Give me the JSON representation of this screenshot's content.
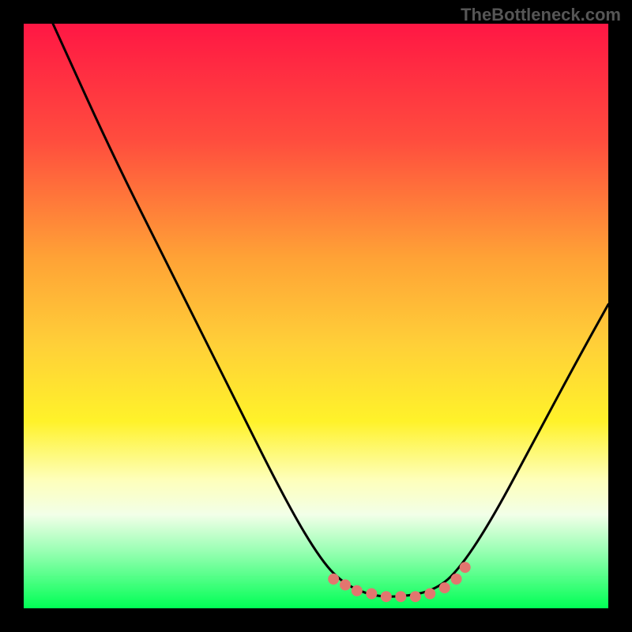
{
  "watermark": "TheBottleneck.com",
  "colors": {
    "bg": "#000000",
    "watermark_text": "#565656",
    "curve": "#000000",
    "marker": "#e2766f",
    "green": "#00ff55"
  },
  "chart_data": {
    "type": "line",
    "title": "",
    "xlabel": "",
    "ylabel": "",
    "xlim": [
      0,
      100
    ],
    "ylim": [
      0,
      100
    ],
    "gradient_stops": [
      {
        "offset": 0,
        "color": "#ff1744"
      },
      {
        "offset": 25,
        "color": "#ff6a3c"
      },
      {
        "offset": 50,
        "color": "#ffd038"
      },
      {
        "offset": 68,
        "color": "#fff22a"
      },
      {
        "offset": 80,
        "color": "#f8ffcc"
      },
      {
        "offset": 95,
        "color": "#35ff66"
      },
      {
        "offset": 100,
        "color": "#00ff55"
      }
    ],
    "series": [
      {
        "name": "bottleneck-curve",
        "points": [
          {
            "x": 5,
            "y": 100
          },
          {
            "x": 15,
            "y": 78
          },
          {
            "x": 25,
            "y": 58
          },
          {
            "x": 35,
            "y": 38
          },
          {
            "x": 45,
            "y": 18
          },
          {
            "x": 51,
            "y": 8
          },
          {
            "x": 55,
            "y": 4
          },
          {
            "x": 60,
            "y": 2
          },
          {
            "x": 65,
            "y": 2
          },
          {
            "x": 70,
            "y": 3
          },
          {
            "x": 74,
            "y": 6
          },
          {
            "x": 80,
            "y": 15
          },
          {
            "x": 88,
            "y": 30
          },
          {
            "x": 95,
            "y": 43
          },
          {
            "x": 100,
            "y": 52
          }
        ]
      }
    ],
    "markers": [
      {
        "x": 53,
        "y": 5
      },
      {
        "x": 55,
        "y": 4
      },
      {
        "x": 57,
        "y": 3
      },
      {
        "x": 59.5,
        "y": 2.5
      },
      {
        "x": 62,
        "y": 2
      },
      {
        "x": 64.5,
        "y": 2
      },
      {
        "x": 67,
        "y": 2
      },
      {
        "x": 69.5,
        "y": 2.5
      },
      {
        "x": 72,
        "y": 3.5
      },
      {
        "x": 74,
        "y": 5
      },
      {
        "x": 75.5,
        "y": 7
      }
    ]
  }
}
